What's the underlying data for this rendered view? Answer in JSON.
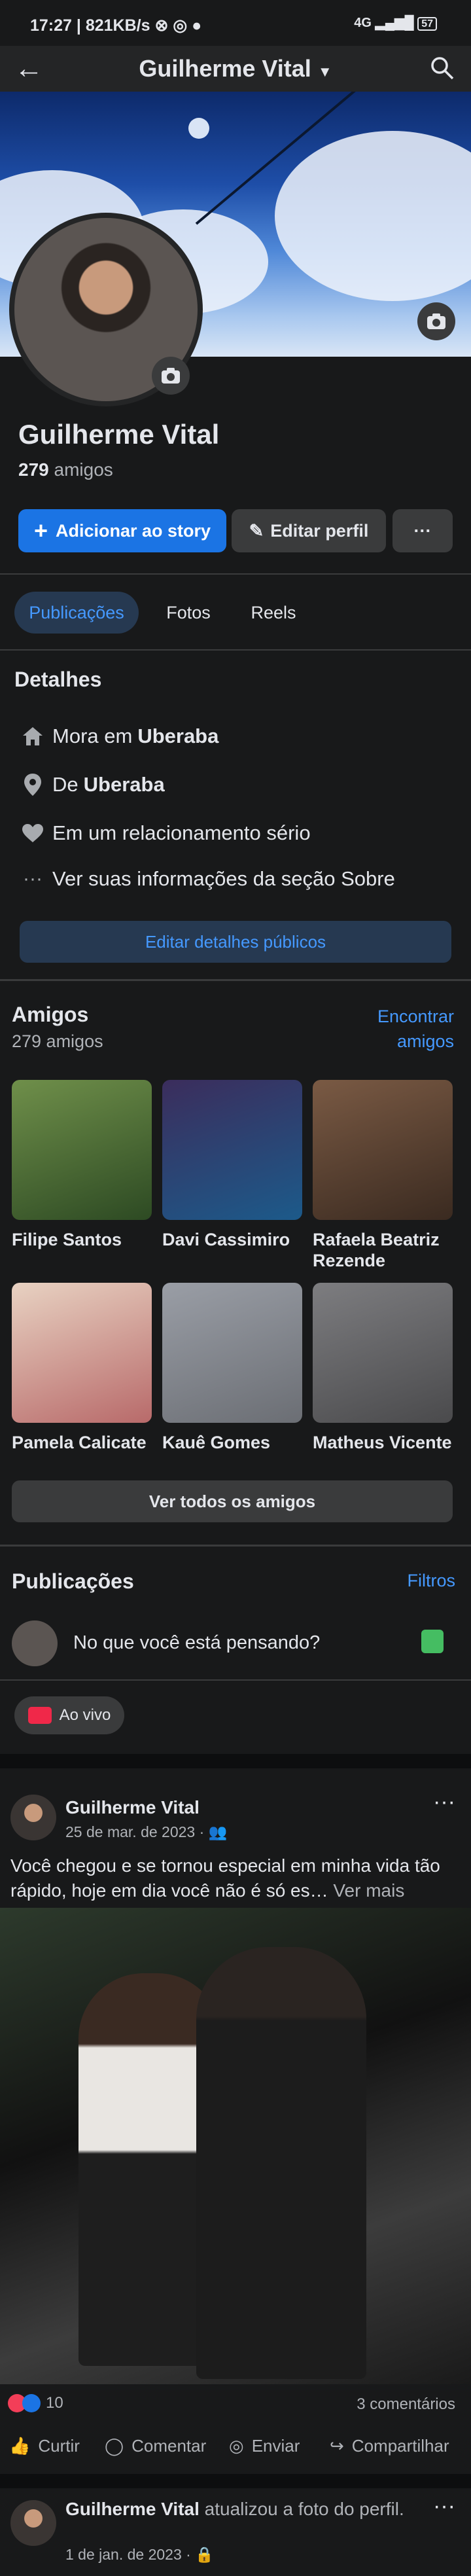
{
  "status_bar": {
    "time": "17:27",
    "net_speed": "821KB/s",
    "signal": "4G",
    "battery": "57"
  },
  "nav": {
    "title": "Guilherme Vital"
  },
  "profile": {
    "name": "Guilherme Vital",
    "friends_count": "279",
    "friends_label": "amigos",
    "add_story_label": "Adicionar ao story",
    "edit_profile_label": "Editar perfil",
    "more_label": "···"
  },
  "tabs": [
    "Publicações",
    "Fotos",
    "Reels"
  ],
  "details": {
    "title": "Detalhes",
    "lives_prefix": "Mora em",
    "lives_city": "Uberaba",
    "from_prefix": "De",
    "from_city": "Uberaba",
    "relationship": "Em um relacionamento sério",
    "about_link": "Ver suas informações da seção Sobre",
    "edit_button": "Editar detalhes públicos"
  },
  "friends": {
    "title": "Amigos",
    "count_text": "279 amigos",
    "find_link_1": "Encontrar",
    "find_link_2": "amigos",
    "list": [
      {
        "name": "Filipe Santos",
        "color": "#6f8f4a"
      },
      {
        "name": "Davi Cassimiro",
        "color": "#3b2d5c"
      },
      {
        "name": "Rafaela Beatriz Rezende",
        "color": "#7a5a44"
      },
      {
        "name": "Pamela Calicate",
        "color": "#b86a6a"
      },
      {
        "name": "Kauê Gomes",
        "color": "#6b6e74"
      },
      {
        "name": "Matheus Vicente",
        "color": "#5a5a5c"
      }
    ],
    "see_all": "Ver todos os amigos"
  },
  "posts_section": {
    "title": "Publicações",
    "filter_link": "Filtros",
    "composer_placeholder": "No que você está pensando?",
    "live_label": "Ao vivo"
  },
  "post1": {
    "author": "Guilherme Vital",
    "date": "25 de mar. de 2023 ·",
    "text": "Você chegou e se tornou especial em minha vida tão rápido, hoje em dia você não é só es…",
    "see_more": "Ver mais",
    "reaction_count": "10",
    "comments": "3 comentários",
    "actions": [
      "Curtir",
      "Comentar",
      "Enviar",
      "Compartilhar"
    ]
  },
  "post2": {
    "author": "Guilherme Vital",
    "action_text": "atualizou a foto do perfil.",
    "date": "1 de jan. de 2023 ·"
  }
}
